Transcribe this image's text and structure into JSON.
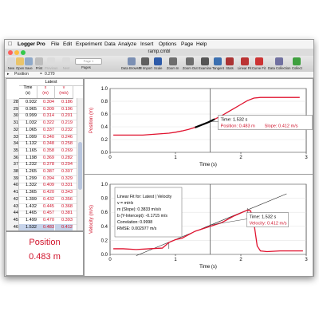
{
  "menubar": {
    "app_name": "Logger Pro",
    "items": [
      "File",
      "Edit",
      "Experiment",
      "Data",
      "Analyze",
      "Insert",
      "Options",
      "Page",
      "Help"
    ]
  },
  "window": {
    "title": "ramp.cmbl"
  },
  "toolbar": {
    "buttons": [
      {
        "label": "New",
        "icon": "new-file-icon",
        "enabled": true
      },
      {
        "label": "Open",
        "icon": "open-folder-icon",
        "enabled": true
      },
      {
        "label": "Save",
        "icon": "save-icon",
        "enabled": true
      },
      {
        "label": "Print",
        "icon": "printer-icon",
        "enabled": true
      },
      {
        "label": "Previous",
        "icon": "previous-page-icon",
        "enabled": false
      },
      {
        "label": "Next",
        "icon": "next-page-icon",
        "enabled": false
      },
      {
        "label": "Data Browser",
        "icon": "data-browser-icon",
        "enabled": true
      },
      {
        "label": "TI Import",
        "icon": "ti-import-icon",
        "enabled": true
      },
      {
        "label": "Scale",
        "icon": "autoscale-icon",
        "enabled": true
      },
      {
        "label": "Zoom In",
        "icon": "zoom-in-icon",
        "enabled": true
      },
      {
        "label": "Zoom Out",
        "icon": "zoom-out-icon",
        "enabled": true
      },
      {
        "label": "Examine",
        "icon": "examine-icon",
        "enabled": true
      },
      {
        "label": "Tangent",
        "icon": "tangent-icon",
        "enabled": true
      },
      {
        "label": "Stats",
        "icon": "stats-icon",
        "enabled": true
      },
      {
        "label": "Linear Fit",
        "icon": "linear-fit-icon",
        "enabled": true
      },
      {
        "label": "Curve Fit",
        "icon": "curve-fit-icon",
        "enabled": true
      },
      {
        "label": "Data Collection",
        "icon": "data-collection-icon",
        "enabled": true
      },
      {
        "label": "Collect",
        "icon": "collect-icon",
        "enabled": true
      }
    ],
    "page_selector": "Page 1",
    "pages_label": "Pages"
  },
  "status": {
    "column": "Position",
    "equals": "=",
    "value": "0.270"
  },
  "table": {
    "dataset": "Latest",
    "headers": [
      {
        "name": "Time",
        "unit": "(s)"
      },
      {
        "name": "x",
        "unit": "(m)"
      },
      {
        "name": "v",
        "unit": "(m/s)"
      }
    ],
    "rows": [
      {
        "n": "28",
        "t": "0.932",
        "x": "0.304",
        "v": "0.186"
      },
      {
        "n": "29",
        "t": "0.965",
        "x": "0.309",
        "v": "0.196"
      },
      {
        "n": "30",
        "t": "0.999",
        "x": "0.314",
        "v": "0.201"
      },
      {
        "n": "31",
        "t": "1.032",
        "x": "0.322",
        "v": "0.219"
      },
      {
        "n": "32",
        "t": "1.065",
        "x": "0.337",
        "v": "0.232"
      },
      {
        "n": "33",
        "t": "1.099",
        "x": "0.340",
        "v": "0.246"
      },
      {
        "n": "34",
        "t": "1.132",
        "x": "0.348",
        "v": "0.258"
      },
      {
        "n": "35",
        "t": "1.165",
        "x": "0.358",
        "v": "0.269"
      },
      {
        "n": "36",
        "t": "1.198",
        "x": "0.369",
        "v": "0.282"
      },
      {
        "n": "37",
        "t": "1.232",
        "x": "0.378",
        "v": "0.294"
      },
      {
        "n": "38",
        "t": "1.265",
        "x": "0.387",
        "v": "0.307"
      },
      {
        "n": "39",
        "t": "1.299",
        "x": "0.394",
        "v": "0.329"
      },
      {
        "n": "40",
        "t": "1.332",
        "x": "0.409",
        "v": "0.331"
      },
      {
        "n": "41",
        "t": "1.365",
        "x": "0.420",
        "v": "0.343"
      },
      {
        "n": "42",
        "t": "1.399",
        "x": "0.432",
        "v": "0.356"
      },
      {
        "n": "43",
        "t": "1.432",
        "x": "0.445",
        "v": "0.368"
      },
      {
        "n": "44",
        "t": "1.465",
        "x": "0.457",
        "v": "0.381"
      },
      {
        "n": "45",
        "t": "1.499",
        "x": "0.470",
        "v": "0.393"
      },
      {
        "n": "46",
        "t": "1.532",
        "x": "0.483",
        "v": "0.412"
      }
    ],
    "selected_row": 18
  },
  "meter": {
    "label": "Position",
    "value": "0.483 m"
  },
  "chart_data": [
    {
      "type": "line",
      "ylabel": "Position (m)",
      "xlabel": "Time (s)",
      "xlim": [
        0,
        3
      ],
      "ylim": [
        0,
        1.0
      ],
      "x_ticks": [
        "0",
        "1",
        "2",
        "3"
      ],
      "y_ticks": [
        "0.0",
        "0.2",
        "0.4",
        "0.6",
        "0.8",
        "1.0"
      ],
      "series": [
        {
          "color": "#e0132f",
          "x": [
            0.05,
            0.5,
            0.9,
            1.0,
            1.1,
            1.2,
            1.3,
            1.4,
            1.5,
            1.6,
            1.7,
            1.8,
            1.9,
            2.0,
            2.1,
            2.2,
            2.3,
            2.5,
            2.7,
            2.9
          ],
          "y": [
            0.27,
            0.27,
            0.3,
            0.315,
            0.335,
            0.36,
            0.39,
            0.43,
            0.47,
            0.52,
            0.57,
            0.63,
            0.69,
            0.75,
            0.81,
            0.85,
            0.86,
            0.86,
            0.86,
            0.86
          ]
        }
      ],
      "examine_time": 1.532,
      "tangent_range": [
        1.33,
        1.6
      ],
      "annotation": {
        "time_label": "Time: 1.532 s",
        "position_label": "Position: 0.483 m",
        "slope_label": "Slope: 0.412 m/s"
      }
    },
    {
      "type": "line",
      "ylabel": "Velocity (m/s)",
      "xlabel": "Time (s)",
      "xlim": [
        0,
        3
      ],
      "ylim": [
        0,
        1.0
      ],
      "x_ticks": [
        "0",
        "1",
        "2",
        "3"
      ],
      "y_ticks": [
        "0.0",
        "0.2",
        "0.4",
        "0.6",
        "0.8",
        "1.0"
      ],
      "series": [
        {
          "color": "#e0132f",
          "x": [
            0.05,
            0.2,
            0.4,
            0.6,
            0.8,
            0.9,
            1.0,
            1.1,
            1.2,
            1.3,
            1.4,
            1.5,
            1.6,
            1.7,
            1.8,
            1.9,
            2.0,
            2.1,
            2.15,
            2.2,
            2.25,
            2.3,
            2.4,
            2.6,
            2.8,
            2.95
          ],
          "y": [
            0.08,
            0.08,
            0.07,
            0.08,
            0.09,
            0.17,
            0.21,
            0.23,
            0.28,
            0.33,
            0.36,
            0.39,
            0.42,
            0.45,
            0.5,
            0.55,
            0.59,
            0.63,
            0.62,
            0.45,
            0.12,
            0.05,
            0.04,
            0.05,
            0.05,
            0.05
          ]
        }
      ],
      "fit_line": {
        "m": 0.3833,
        "b": -0.1715,
        "range": [
          0.4,
          2.7
        ]
      },
      "fit_bracket": [
        0.9,
        2.1
      ],
      "examine_time": 1.532,
      "fit_annotation": {
        "title": "Linear Fit for: Latest | Velocity",
        "equation": "v = mt+b",
        "m_label": "m (Slope): 0.3833 m/s/s",
        "b_label": "b (Y-Intercept): -0.1715 m/s",
        "corr_label": "Correlation: 0.9998",
        "rmse_label": "RMSE: 0.002977 m/s"
      },
      "annotation": {
        "time_label": "Time: 1.532 s",
        "velocity_label": "Velocity: 0.412 m/s"
      }
    }
  ],
  "colors": {
    "data_red": "#e0132f",
    "selection_blue": "#c6d3ea"
  }
}
